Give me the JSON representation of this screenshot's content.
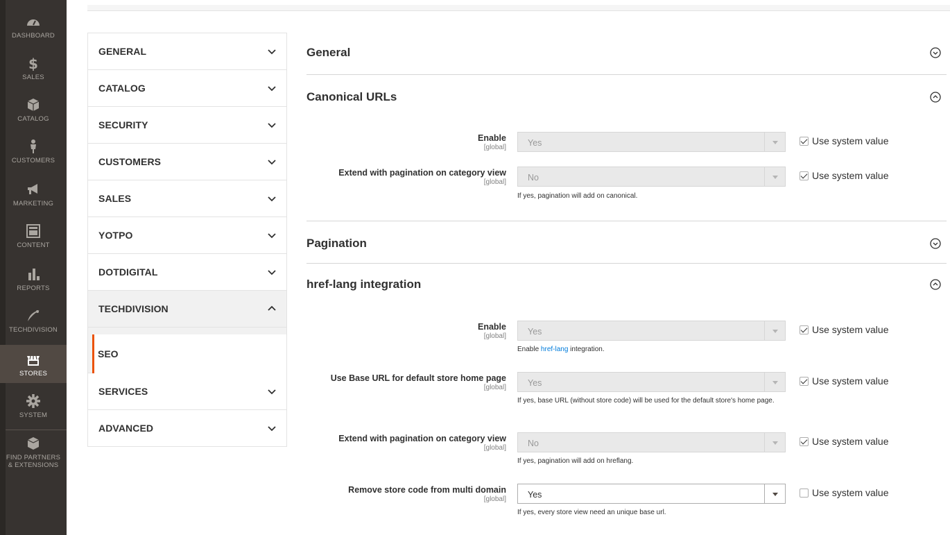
{
  "admin_menu": [
    {
      "label": "DASHBOARD",
      "icon": "dashboard-icon"
    },
    {
      "label": "SALES",
      "icon": "dollar-icon"
    },
    {
      "label": "CATALOG",
      "icon": "box-icon"
    },
    {
      "label": "CUSTOMERS",
      "icon": "person-icon"
    },
    {
      "label": "MARKETING",
      "icon": "megaphone-icon"
    },
    {
      "label": "CONTENT",
      "icon": "layout-icon"
    },
    {
      "label": "REPORTS",
      "icon": "bar-chart-icon"
    },
    {
      "label": "TECHDIVISION",
      "icon": "techdivision-logo-icon"
    },
    {
      "label": "STORES",
      "icon": "storefront-icon"
    },
    {
      "label": "SYSTEM",
      "icon": "gear-icon"
    },
    {
      "label": "FIND PARTNERS",
      "label2": "& EXTENSIONS",
      "icon": "partners-box-icon"
    }
  ],
  "tabs": [
    {
      "label": "GENERAL"
    },
    {
      "label": "CATALOG"
    },
    {
      "label": "SECURITY"
    },
    {
      "label": "CUSTOMERS"
    },
    {
      "label": "SALES"
    },
    {
      "label": "YOTPO"
    },
    {
      "label": "DOTDIGITAL"
    },
    {
      "label": "TECHDIVISION"
    },
    {
      "label": "SERVICES"
    },
    {
      "label": "ADVANCED"
    }
  ],
  "techdivision_sub": {
    "label": "SEO"
  },
  "sections": {
    "general": {
      "title": "General"
    },
    "canonical": {
      "title": "Canonical URLs"
    },
    "pagination": {
      "title": "Pagination"
    },
    "hreflang": {
      "title": "href-lang integration"
    }
  },
  "canonical_fields": {
    "enable": {
      "label": "Enable",
      "scope": "[global]",
      "value": "Yes",
      "system_label": "Use system value"
    },
    "extend": {
      "label": "Extend with pagination on category view",
      "scope": "[global]",
      "value": "No",
      "note": "If yes, pagination will add on canonical.",
      "system_label": "Use system value"
    }
  },
  "hreflang_fields": {
    "enable": {
      "label": "Enable",
      "scope": "[global]",
      "value": "Yes",
      "note_pre": "Enable ",
      "note_link": "href-lang",
      "note_post": " integration.",
      "system_label": "Use system value"
    },
    "base_url": {
      "label": "Use Base URL for default store home page",
      "scope": "[global]",
      "value": "Yes",
      "note": "If yes, base URL (without store code) will be used for the default store's home page.",
      "system_label": "Use system value"
    },
    "extend": {
      "label": "Extend with pagination on category view",
      "scope": "[global]",
      "value": "No",
      "note": "If yes, pagination will add on hreflang.",
      "system_label": "Use system value"
    },
    "remove_code": {
      "label": "Remove store code from multi domain",
      "scope": "[global]",
      "value": "Yes",
      "note": "If yes, every store view need an unique base url.",
      "system_label": "Use system value"
    }
  },
  "colors": {
    "menu_bg": "#373330",
    "active_bg": "#514943",
    "accent": "#eb5202",
    "link": "#007bdb"
  }
}
